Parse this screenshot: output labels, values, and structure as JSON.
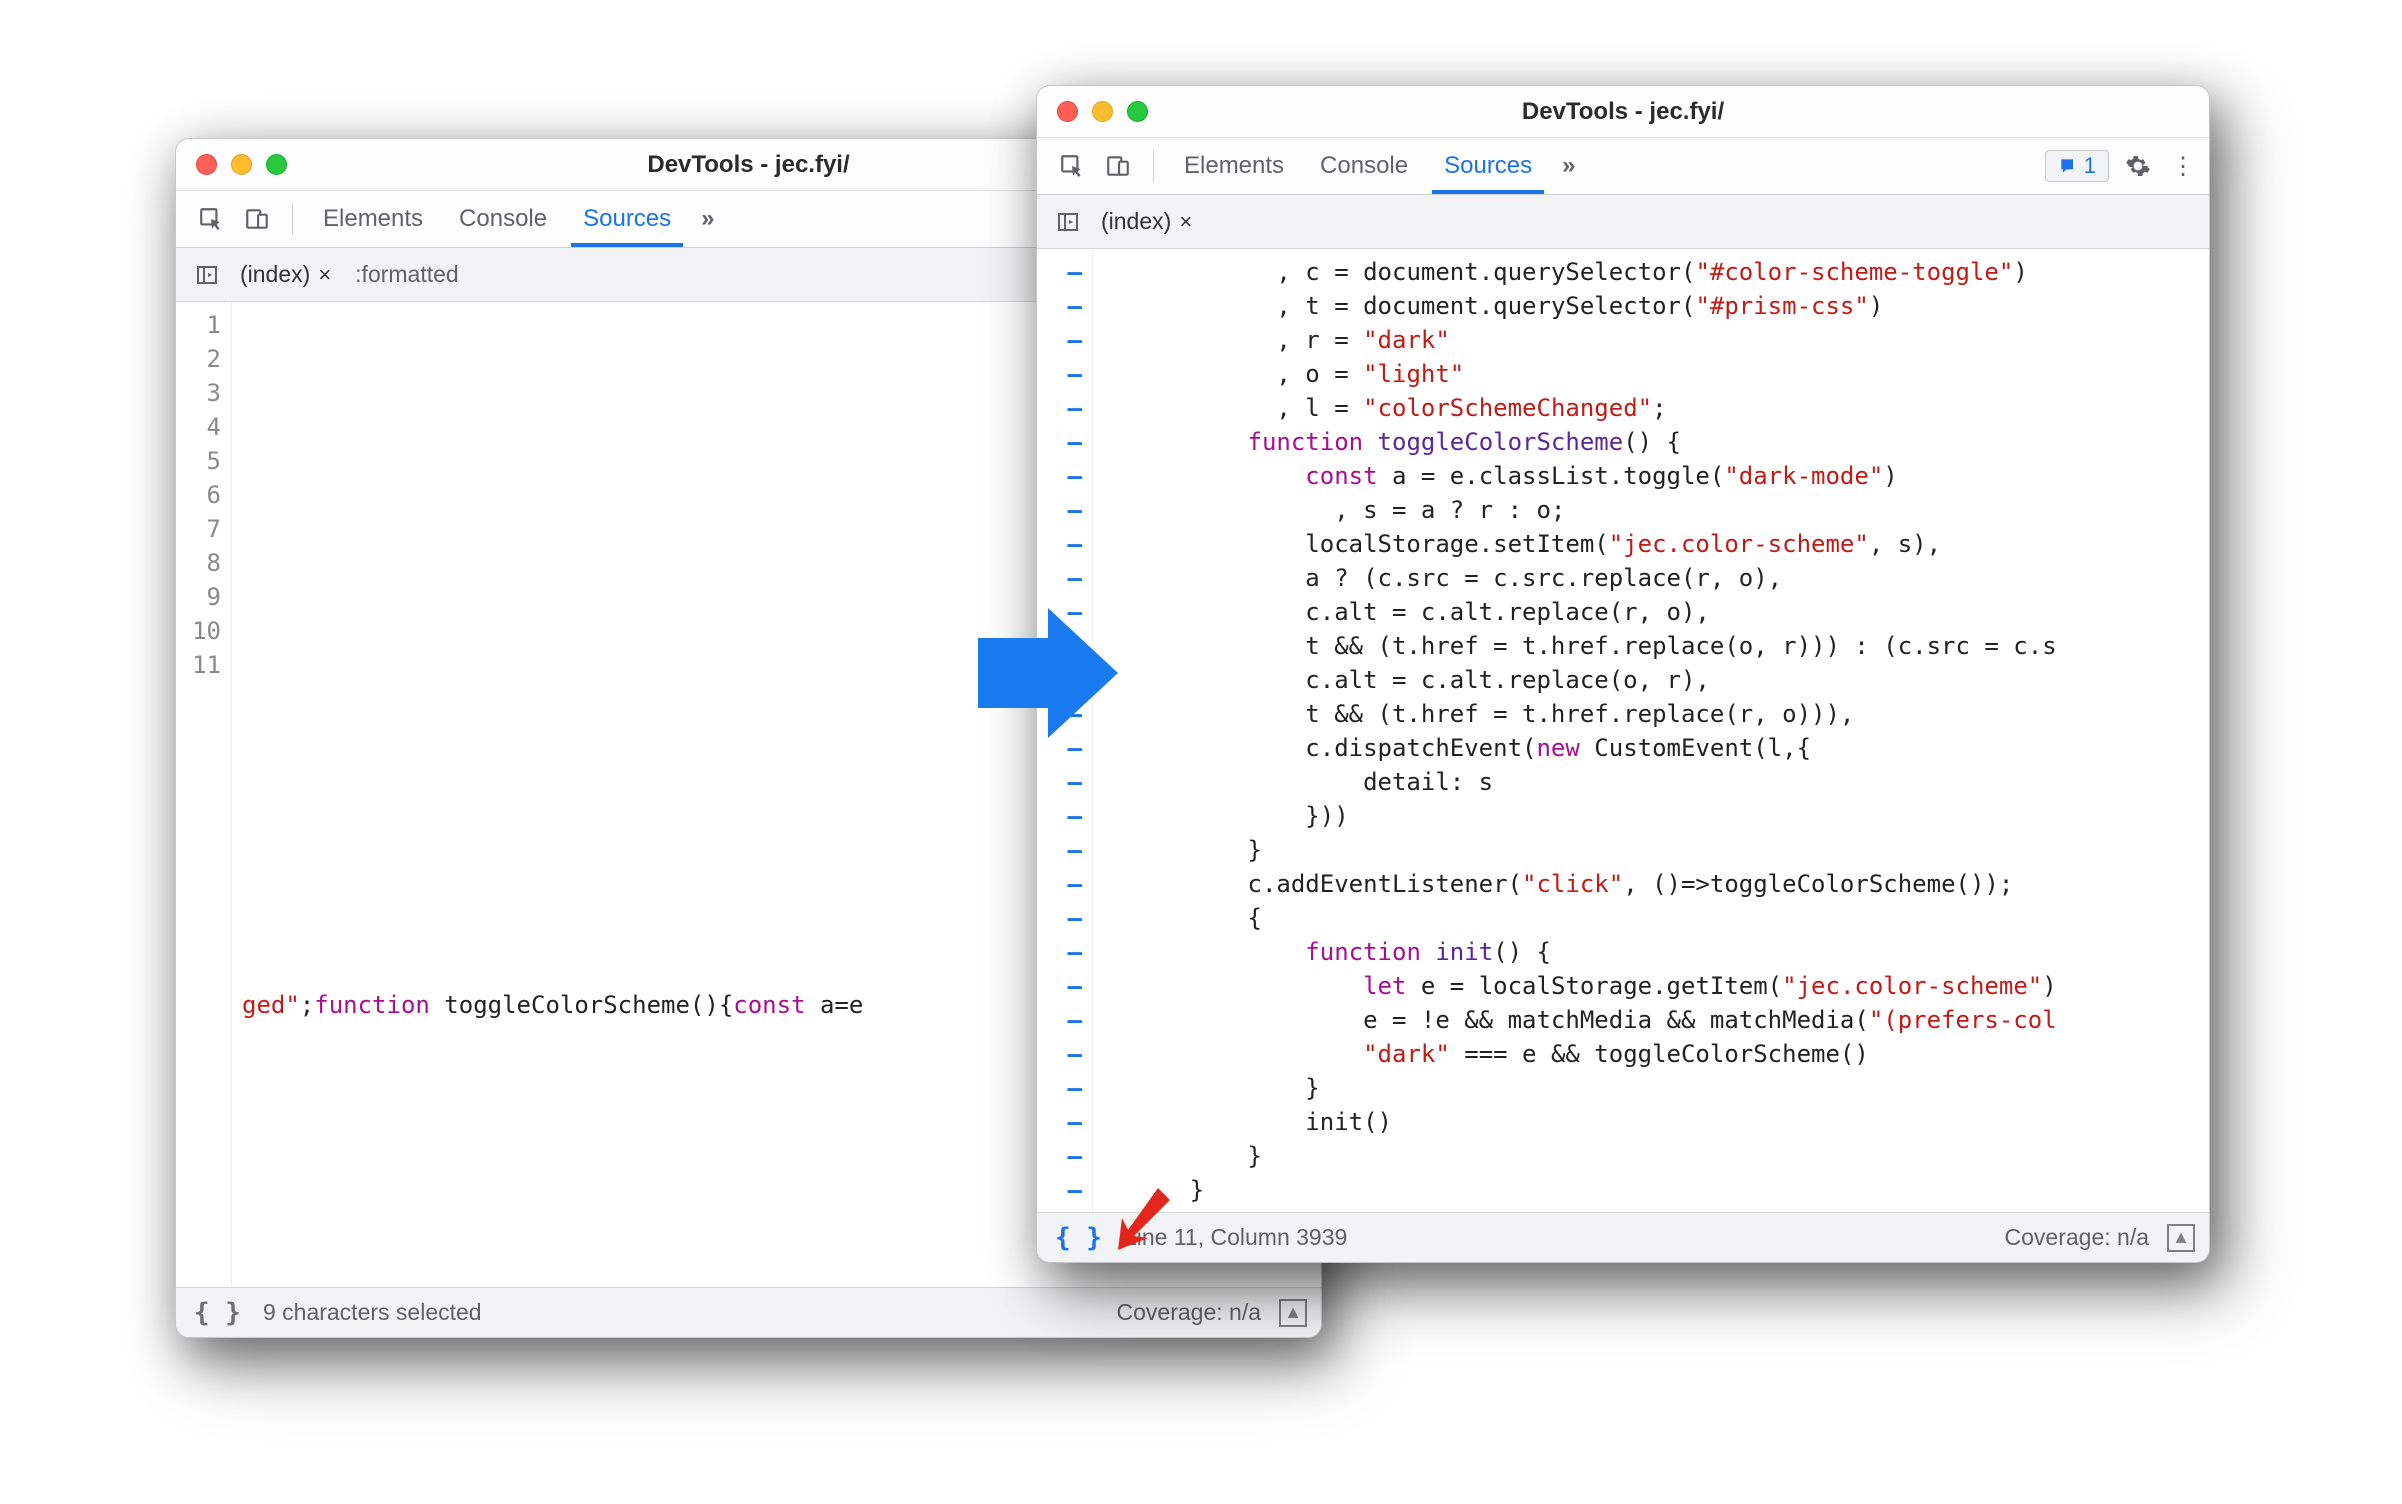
{
  "left_window": {
    "title": "DevTools - jec.fyi/",
    "tabs": {
      "elements": "Elements",
      "console": "Console",
      "sources": "Sources",
      "more": "»"
    },
    "subbar": {
      "file": "(index)",
      "close": "×",
      "extra": ":formatted"
    },
    "gutter": [
      "1",
      "2",
      "3",
      "4",
      "5",
      "6",
      "7",
      "8",
      "9",
      "10",
      "11"
    ],
    "code_line11_prefix": "ged\"",
    "code_line11_punc1": ";",
    "code_line11_kw1": "function",
    "code_line11_fn": " toggleColorScheme(){",
    "code_line11_kw2": "const",
    "code_line11_tail": " a=e",
    "status": {
      "format_on": false,
      "msg": "9 characters selected",
      "coverage": "Coverage: n/a"
    }
  },
  "right_window": {
    "title": "DevTools - jec.fyi/",
    "tabs": {
      "elements": "Elements",
      "console": "Console",
      "sources": "Sources",
      "more": "»"
    },
    "issues_badge": "1",
    "subbar": {
      "file": "(index)",
      "close": "×"
    },
    "code": [
      {
        "type": "decl",
        "indent": "            , ",
        "v": "c",
        "rest": " = document.querySelector(",
        "str": "\"#color-scheme-toggle\"",
        "tail": ")"
      },
      {
        "type": "decl",
        "indent": "            , ",
        "v": "t",
        "rest": " = document.querySelector(",
        "str": "\"#prism-css\"",
        "tail": ")"
      },
      {
        "type": "decl",
        "indent": "            , ",
        "v": "r",
        "rest": " = ",
        "str": "\"dark\"",
        "tail": ""
      },
      {
        "type": "decl",
        "indent": "            , ",
        "v": "o",
        "rest": " = ",
        "str": "\"light\"",
        "tail": ""
      },
      {
        "type": "decl",
        "indent": "            , ",
        "v": "l",
        "rest": " = ",
        "str": "\"colorSchemeChanged\"",
        "tail": ";"
      },
      {
        "type": "func",
        "indent": "          ",
        "kw": "function",
        "name": " toggleColorScheme",
        "sig": "() {"
      },
      {
        "type": "const2",
        "indent": "              ",
        "kw": "const",
        "mid": " a = e.classList.toggle(",
        "str": "\"dark-mode\"",
        "tail": ")"
      },
      {
        "type": "plain",
        "indent": "                , ",
        "text": "s = a ? r : o;"
      },
      {
        "type": "call",
        "indent": "              ",
        "pre": "localStorage.setItem(",
        "str": "\"jec.color-scheme\"",
        "post": ", s),"
      },
      {
        "type": "plain",
        "indent": "              ",
        "text": "a ? (c.src = c.src.replace(r, o),"
      },
      {
        "type": "plain",
        "indent": "              ",
        "text": "c.alt = c.alt.replace(r, o),"
      },
      {
        "type": "plain",
        "indent": "              ",
        "text": "t && (t.href = t.href.replace(o, r))) : (c.src = c.s"
      },
      {
        "type": "plain",
        "indent": "              ",
        "text": "c.alt = c.alt.replace(o, r),"
      },
      {
        "type": "plain",
        "indent": "              ",
        "text": "t && (t.href = t.href.replace(r, o))),"
      },
      {
        "type": "new",
        "indent": "              ",
        "pre": "c.dispatchEvent(",
        "kw": "new",
        "post": " CustomEvent(l,{"
      },
      {
        "type": "plain",
        "indent": "                  ",
        "text": "detail: s"
      },
      {
        "type": "plain",
        "indent": "              ",
        "text": "}))"
      },
      {
        "type": "plain",
        "indent": "          ",
        "text": "}"
      },
      {
        "type": "call",
        "indent": "          ",
        "pre": "c.addEventListener(",
        "str": "\"click\"",
        "post": ", ()=>toggleColorScheme());"
      },
      {
        "type": "plain",
        "indent": "          ",
        "text": "{"
      },
      {
        "type": "func",
        "indent": "              ",
        "kw": "function",
        "name": " init",
        "sig": "() {"
      },
      {
        "type": "let",
        "indent": "                  ",
        "kw": "let",
        "mid": " e = localStorage.getItem(",
        "str": "\"jec.color-scheme\"",
        "tail": ")"
      },
      {
        "type": "call",
        "indent": "                  ",
        "pre": "e = !e && matchMedia && matchMedia(",
        "str": "\"(prefers-col",
        "post": ""
      },
      {
        "type": "call",
        "indent": "                  ",
        "pre": "",
        "str": "\"dark\"",
        "post": " === e && toggleColorScheme()"
      },
      {
        "type": "plain",
        "indent": "              ",
        "text": "}"
      },
      {
        "type": "plain",
        "indent": "              ",
        "text": "init()"
      },
      {
        "type": "plain",
        "indent": "          ",
        "text": "}"
      },
      {
        "type": "plain",
        "indent": "      ",
        "text": "}"
      }
    ],
    "status": {
      "format_on": true,
      "msg": "Line 11, Column 3939",
      "coverage": "Coverage: n/a"
    }
  }
}
